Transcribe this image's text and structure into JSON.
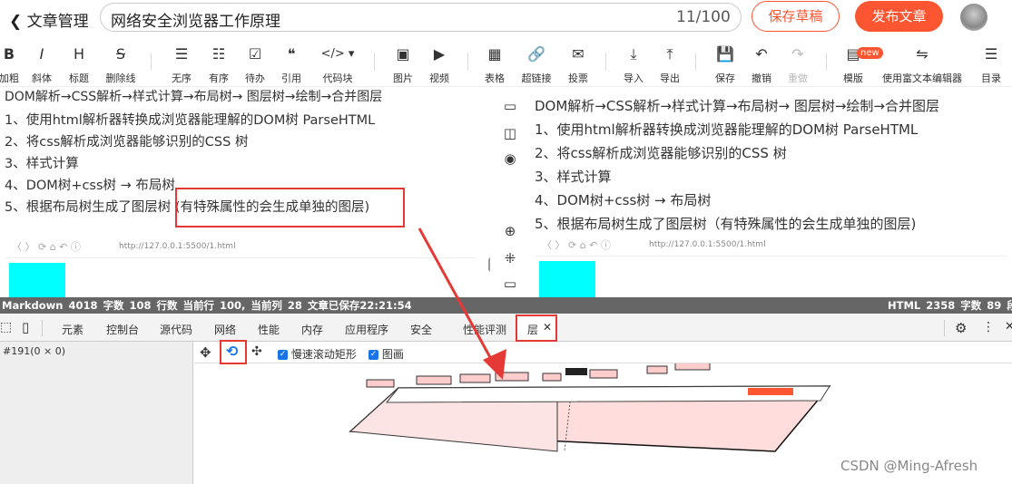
{
  "header": {
    "back_label": "文章管理",
    "title": "网络安全浏览器工作原理",
    "count": "11/100",
    "save_draft": "保存草稿",
    "publish": "发布文章"
  },
  "toolbar": {
    "items": [
      {
        "label": "加粗",
        "icon": "B"
      },
      {
        "label": "斜体",
        "icon": "I"
      },
      {
        "label": "标题",
        "icon": "H"
      },
      {
        "label": "删除线",
        "icon": "S"
      },
      {
        "label": "无序",
        "icon": "☰"
      },
      {
        "label": "有序",
        "icon": "☷"
      },
      {
        "label": "待办",
        "icon": "☑"
      },
      {
        "label": "引用",
        "icon": "❝"
      },
      {
        "label": "代码块",
        "icon": "</> ▾"
      },
      {
        "label": "图片",
        "icon": "▣"
      },
      {
        "label": "视频",
        "icon": "▶"
      },
      {
        "label": "表格",
        "icon": "▦"
      },
      {
        "label": "超链接",
        "icon": "🔗"
      },
      {
        "label": "投票",
        "icon": "✉"
      },
      {
        "label": "导入",
        "icon": "⤓"
      },
      {
        "label": "导出",
        "icon": "⤒"
      },
      {
        "label": "保存",
        "icon": "💾"
      },
      {
        "label": "撤销",
        "icon": "↶"
      },
      {
        "label": "重做",
        "icon": "↷"
      },
      {
        "label": "模版",
        "icon": "▤"
      },
      {
        "label": "使用富文本编辑器",
        "icon": "⇋"
      },
      {
        "label": "目录",
        "icon": "☰"
      }
    ],
    "new_badge": "new"
  },
  "editor": {
    "lines": [
      "DOM解析→CSS解析→样式计算→布局树→ 图层树→绘制→合并图层",
      "1、使用html解析器转换成浏览器能理解的DOM树  ParseHTML",
      "2、将css解析成浏览器能够识别的CSS 树",
      "3、样式计算",
      "4、DOM树+css树 → 布局树",
      "5、根据布局树生成了图层树 (有特殊属性的会生成单独的图层)"
    ],
    "url": "http://127.0.0.1:5500/1.html"
  },
  "preview": {
    "lines": [
      "DOM解析→CSS解析→样式计算→布局树→ 图层树→绘制→合并图层",
      "1、使用html解析器转换成浏览器能理解的DOM树 ParseHTML",
      "2、将css解析成浏览器能够识别的CSS 树",
      "3、样式计算",
      "4、DOM树+css树 → 布局树",
      "5、根据布局树生成了图层树（有特殊属性的会生成单独的图层)"
    ],
    "url": "http://127.0.0.1:5500/1.html"
  },
  "status": {
    "left": "Markdown   4018 字数   108 行数   当前行 100, 当前列 28   文章已保存22:21:54",
    "right": "HTML   2358 字数   89 段落"
  },
  "devtools": {
    "tabs": [
      "元素",
      "控制台",
      "源代码",
      "网络",
      "性能",
      "内存",
      "应用程序",
      "安全",
      "性能评测",
      "层"
    ],
    "node": "#191(0 × 0)",
    "opt1": "慢速滚动矩形",
    "opt2": "图画"
  },
  "watermark": "CSDN @Ming-Afresh",
  "colors": {
    "accent": "#fc5531",
    "highlight": "#e53935",
    "cyan": "#00ffff"
  }
}
